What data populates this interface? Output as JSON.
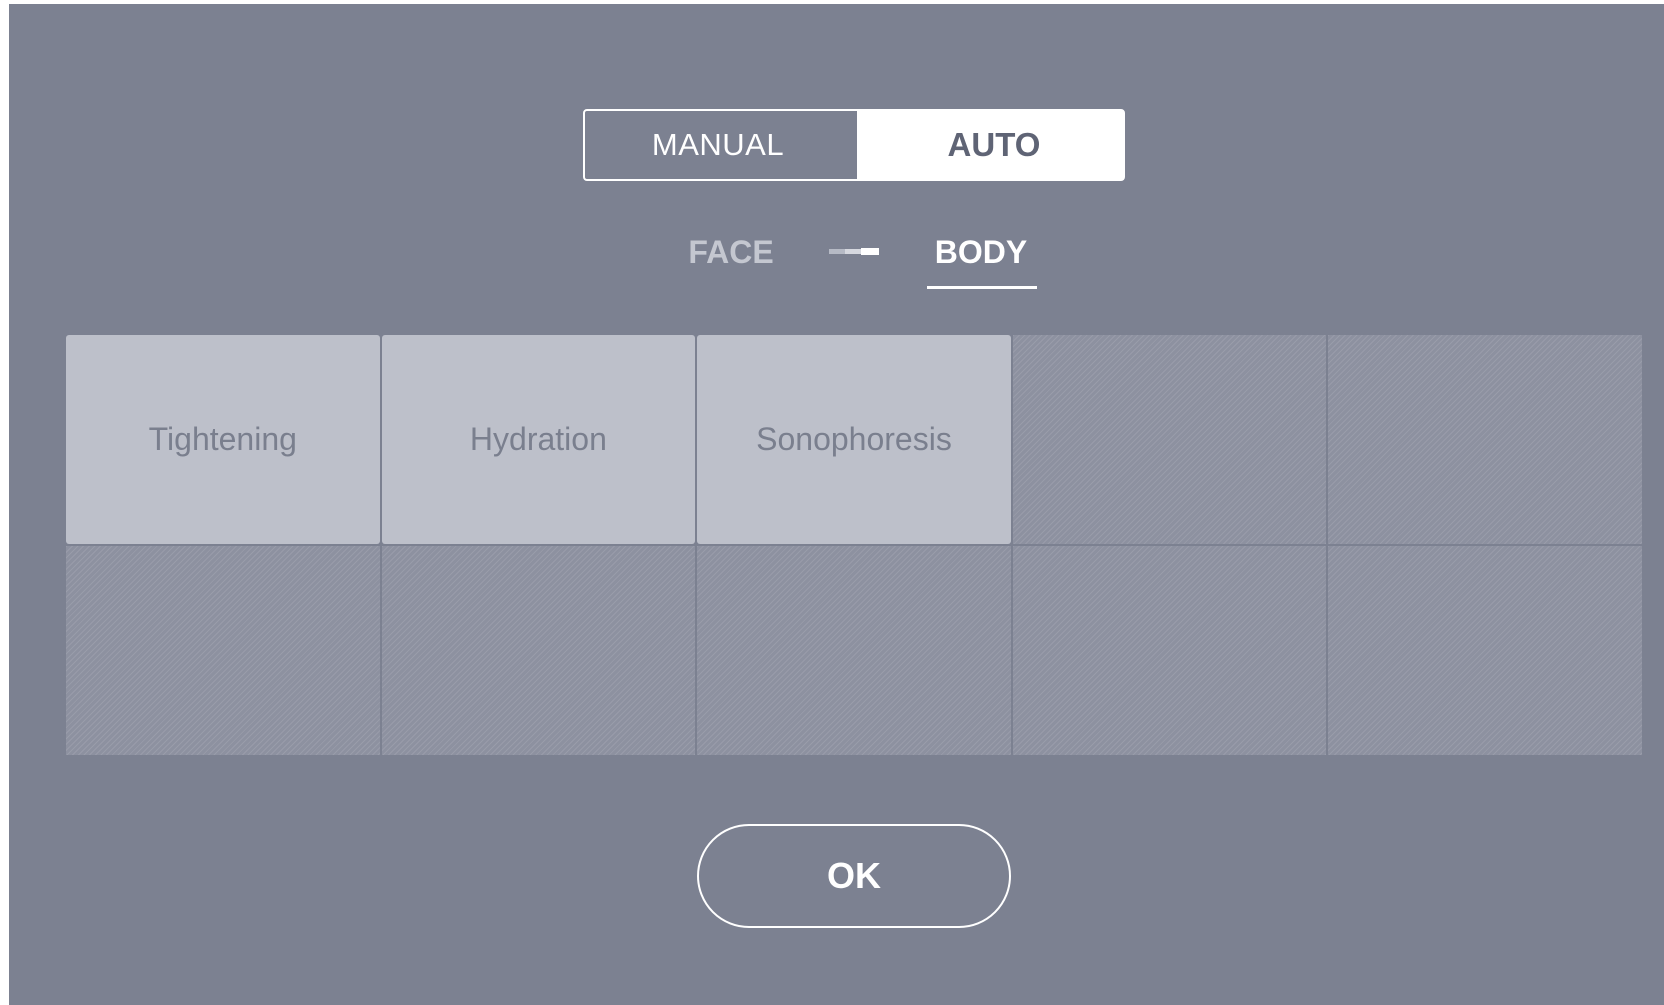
{
  "mode_toggle": {
    "manual_label": "MANUAL",
    "auto_label": "AUTO",
    "selected": "AUTO"
  },
  "area_switch": {
    "face_label": "FACE",
    "body_label": "BODY",
    "selected": "BODY"
  },
  "programs": {
    "items": [
      {
        "label": "Tightening"
      },
      {
        "label": "Hydration"
      },
      {
        "label": "Sonophoresis"
      }
    ],
    "total_slots": 10
  },
  "ok_button": {
    "label": "OK"
  },
  "colors": {
    "background": "#7c8191",
    "program_tile": "#bdc0ca",
    "program_text": "#7a7f8e",
    "active": "#ffffff"
  }
}
